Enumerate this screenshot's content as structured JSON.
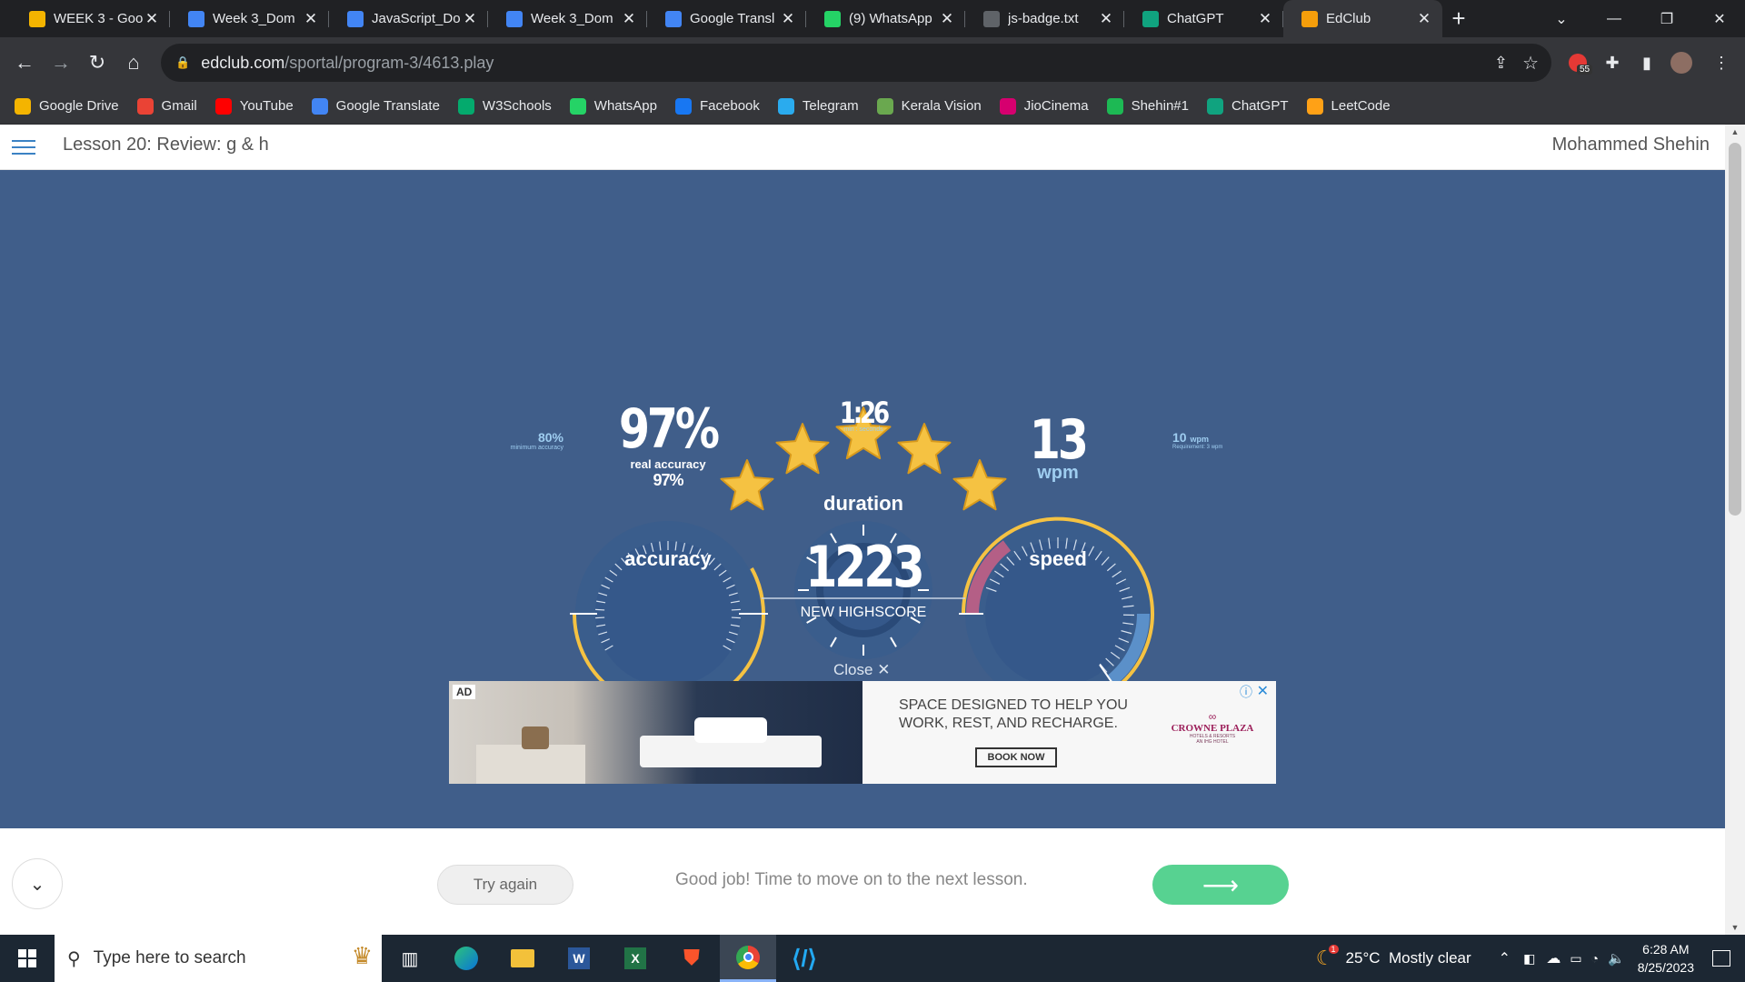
{
  "browser": {
    "tabs": [
      {
        "title": "WEEK 3 - Goo",
        "icon": "google-drive-icon",
        "color": "#f4b400"
      },
      {
        "title": "Week 3_Dom",
        "icon": "google-docs-icon",
        "color": "#4285f4"
      },
      {
        "title": "JavaScript_Do",
        "icon": "google-docs-icon",
        "color": "#4285f4"
      },
      {
        "title": "Week 3_Dom",
        "icon": "google-docs-icon",
        "color": "#4285f4"
      },
      {
        "title": "Google Transl",
        "icon": "google-translate-icon",
        "color": "#4285f4"
      },
      {
        "title": "(9) WhatsApp",
        "icon": "whatsapp-icon",
        "color": "#25d366"
      },
      {
        "title": "js-badge.txt",
        "icon": "globe-icon",
        "color": "#5f6368"
      },
      {
        "title": "ChatGPT",
        "icon": "chatgpt-icon",
        "color": "#10a37f"
      },
      {
        "title": "EdClub",
        "icon": "edclub-icon",
        "color": "#f59e0b"
      }
    ],
    "url_host": "edclub.com",
    "url_path": "/sportal/program-3/4613.play",
    "extension_badge": "55",
    "bookmarks": [
      {
        "label": "Google Drive",
        "color": "#f4b400"
      },
      {
        "label": "Gmail",
        "color": "#ea4335"
      },
      {
        "label": "YouTube",
        "color": "#ff0000"
      },
      {
        "label": "Google Translate",
        "color": "#4285f4"
      },
      {
        "label": "W3Schools",
        "color": "#04aa6d"
      },
      {
        "label": "WhatsApp",
        "color": "#25d366"
      },
      {
        "label": "Facebook",
        "color": "#1877f2"
      },
      {
        "label": "Telegram",
        "color": "#2aabee"
      },
      {
        "label": "Kerala Vision",
        "color": "#6aa84f"
      },
      {
        "label": "JioCinema",
        "color": "#d6006f"
      },
      {
        "label": "Shehin#1",
        "color": "#1db954"
      },
      {
        "label": "ChatGPT",
        "color": "#10a37f"
      },
      {
        "label": "LeetCode",
        "color": "#ffa116"
      }
    ]
  },
  "app": {
    "lesson_title": "Lesson 20: Review: g & h",
    "user_name": "Mohammed Shehin"
  },
  "results": {
    "stars": 5,
    "accuracy": {
      "value": "97%",
      "sub_label": "real accuracy",
      "sub_value": "97%",
      "caption": "accuracy",
      "min_value": "80%",
      "min_label": "minimum accuracy"
    },
    "duration": {
      "value": "1:26",
      "unit": "min : seconds",
      "caption": "duration"
    },
    "speed": {
      "value": "13",
      "unit": "wpm",
      "caption": "speed",
      "req_value": "10",
      "req_unit": "wpm",
      "req_label": "Requirement: 3 wpm"
    },
    "score": {
      "value": "1223",
      "label": "NEW HIGHSCORE"
    }
  },
  "ad": {
    "close_label": "Close",
    "badge": "AD",
    "headline_1": "SPACE DESIGNED TO HELP YOU",
    "headline_2": "WORK, REST, AND RECHARGE.",
    "cta": "BOOK NOW",
    "brand": "CROWNE PLAZA",
    "brand_sub": "HOTELS & RESORTS",
    "brand_sub2": "AN IHG HOTEL"
  },
  "footer": {
    "try_again": "Try again",
    "message": "Good job! Time to move on to the next lesson."
  },
  "taskbar": {
    "search_placeholder": "Type here to search",
    "weather": "25°C  Mostly clear",
    "time": "6:28 AM",
    "date": "8/25/2023",
    "weather_badge": "1"
  },
  "colors": {
    "stage": "#405e8a",
    "gold": "#f5c242",
    "accent": "#57d291"
  }
}
